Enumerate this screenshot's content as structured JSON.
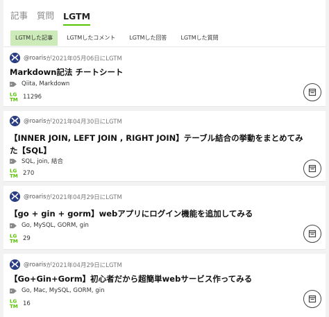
{
  "main_tabs": [
    {
      "label": "記事",
      "active": false
    },
    {
      "label": "質問",
      "active": false
    },
    {
      "label": "LGTM",
      "active": true
    }
  ],
  "sub_tabs": [
    {
      "label": "LGTMした記事",
      "active": true
    },
    {
      "label": "LGTMしたコメント",
      "active": false
    },
    {
      "label": "LGTMした回答",
      "active": false
    },
    {
      "label": "LGTMした質問",
      "active": false
    }
  ],
  "items": [
    {
      "user": "@roaris",
      "suffix": "が2021年05月06日にLGTM",
      "title": "Markdown記法 チートシート",
      "tags": "Qiita, Markdown",
      "lgtm_count": "11296"
    },
    {
      "user": "@roaris",
      "suffix": "が2021年04月30日にLGTM",
      "title": "【INNER JOIN, LEFT JOIN , RIGHT JOIN】テーブル結合の挙動をまとめてみた【SQL】",
      "tags": "SQL, join, 結合",
      "lgtm_count": "270"
    },
    {
      "user": "@roaris",
      "suffix": "が2021年04月29日にLGTM",
      "title": "【go + gin + gorm】webアプリにログイン機能を追加してみる",
      "tags": "Go, MySQL, GORM, gin",
      "lgtm_count": "29"
    },
    {
      "user": "@roaris",
      "suffix": "が2021年04月29日にLGTM",
      "title": "【Go+Gin+Gorm】初心者だから超簡単webサービス作ってみる",
      "tags": "Go, Mac, MySQL, GORM, gin",
      "lgtm_count": "16"
    }
  ],
  "colors": {
    "accent": "#55c500",
    "active_subtab_bg": "#cdebb8",
    "avatar": "#2c3e82"
  }
}
